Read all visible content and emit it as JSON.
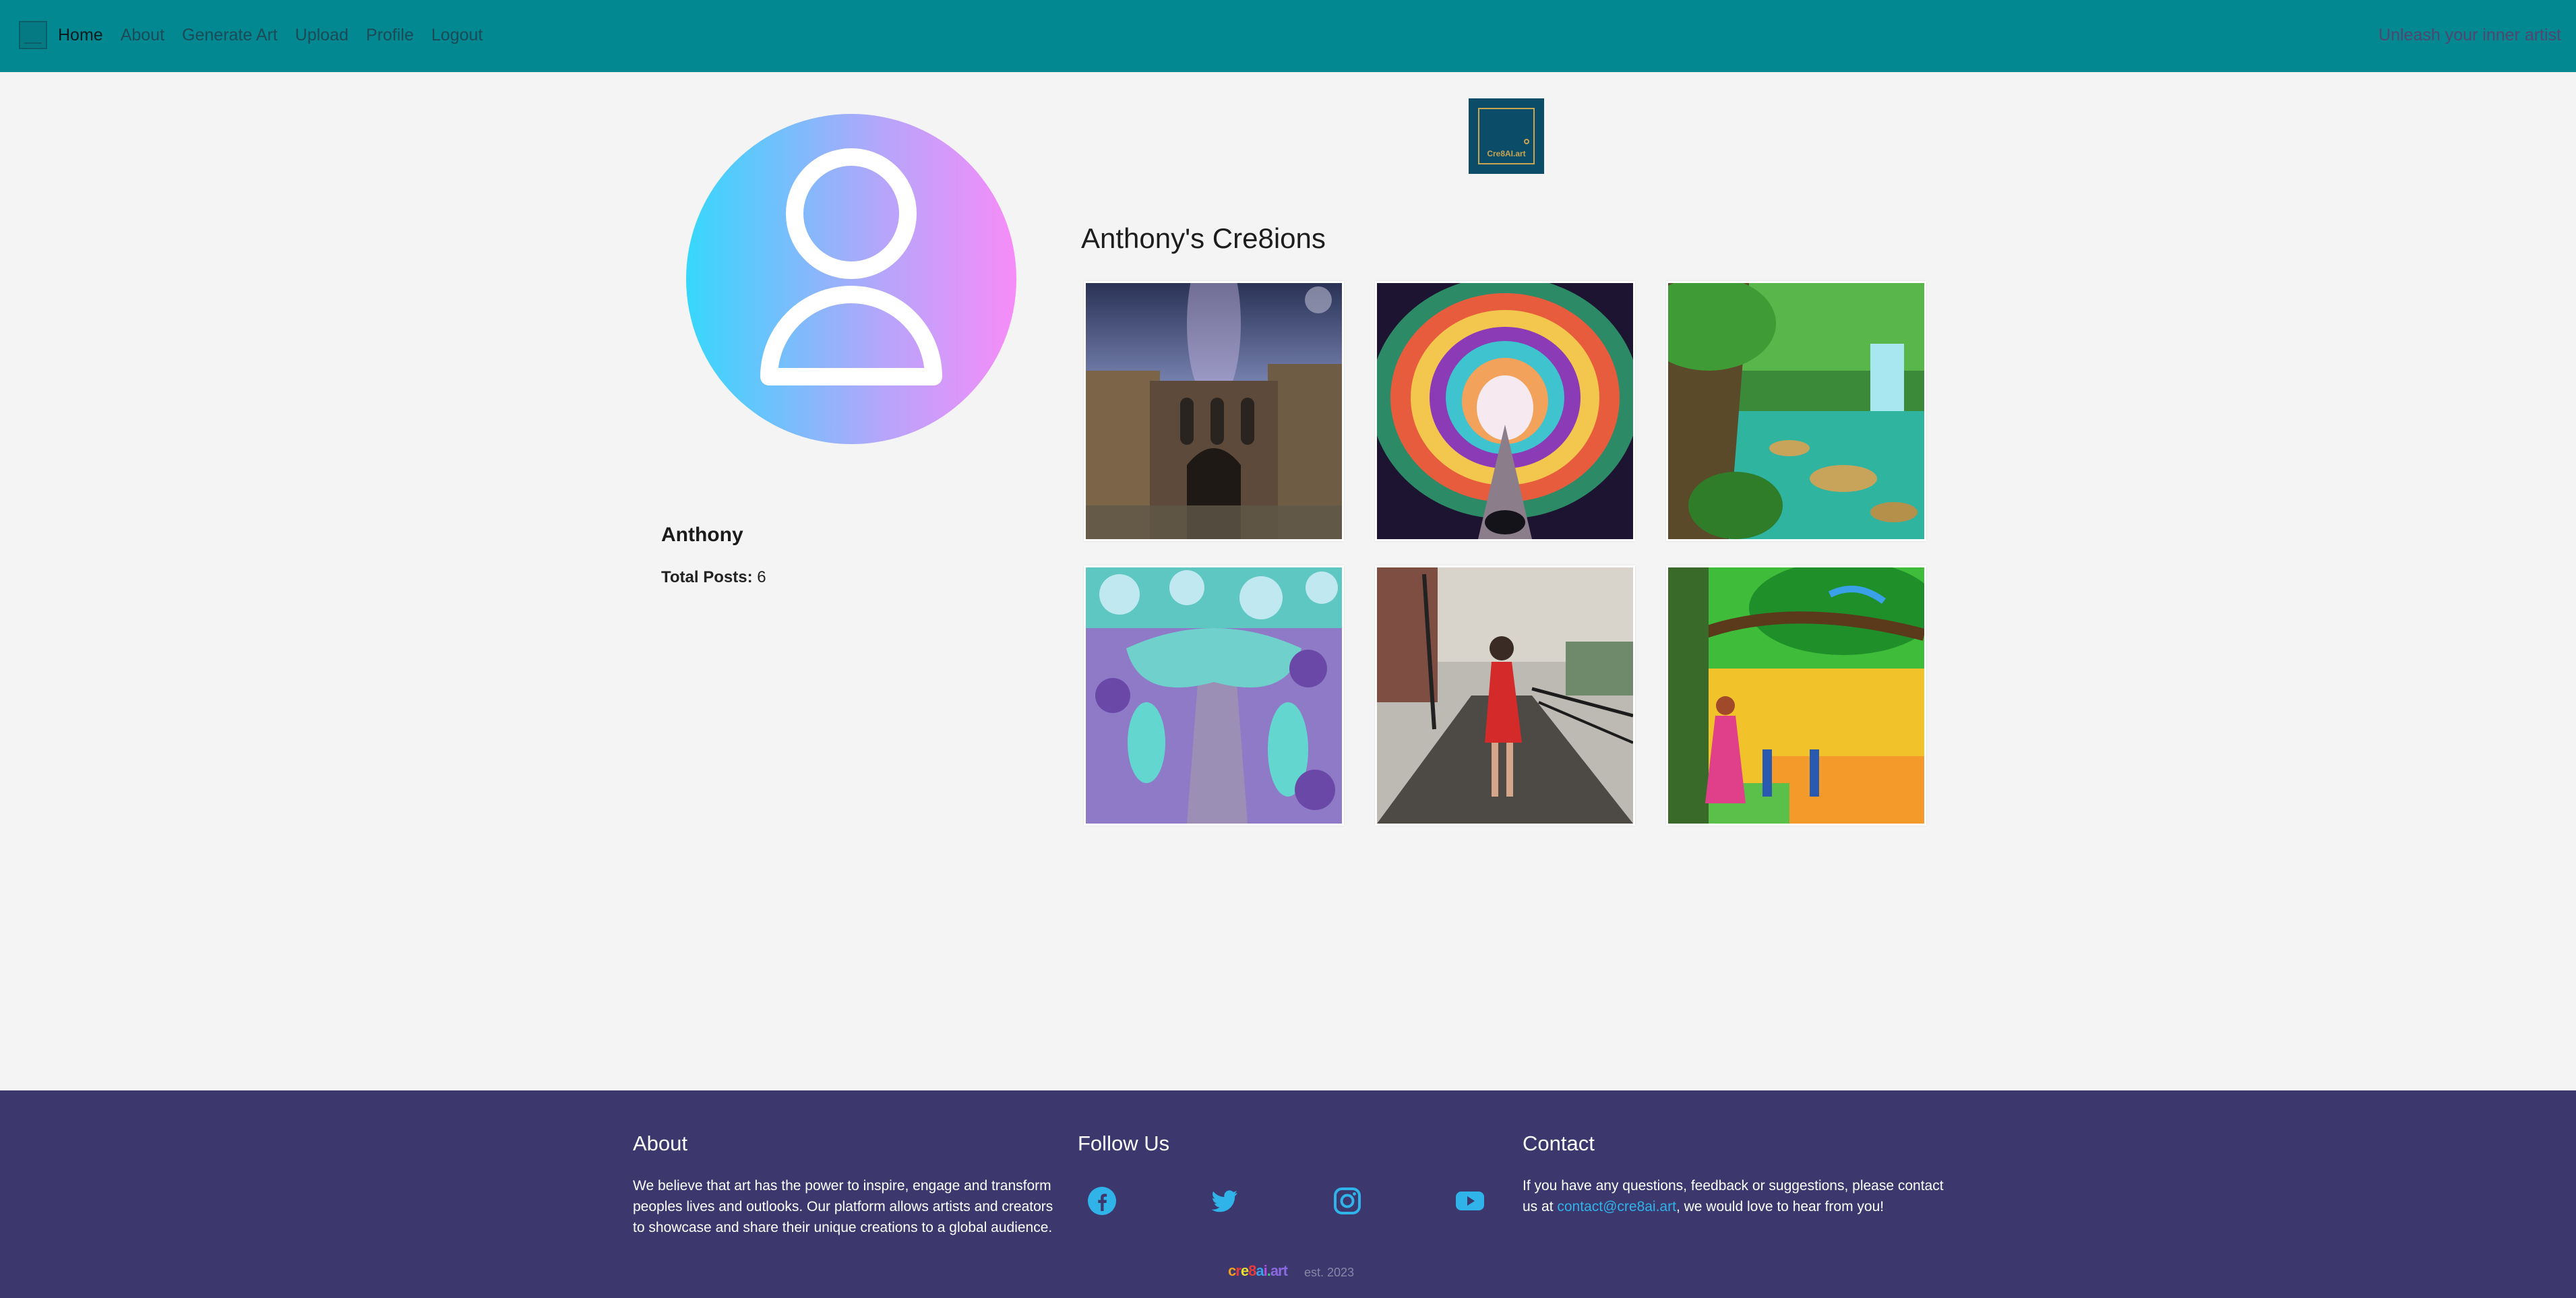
{
  "nav": {
    "links": [
      {
        "label": "Home"
      },
      {
        "label": "About"
      },
      {
        "label": "Generate Art"
      },
      {
        "label": "Upload"
      },
      {
        "label": "Profile"
      },
      {
        "label": "Logout"
      }
    ],
    "tagline": "Unleash your inner artist"
  },
  "profile": {
    "name": "Anthony",
    "total_posts_label": "Total Posts:",
    "total_posts_value": "6"
  },
  "logo": {
    "text": "Cre8AI.art"
  },
  "gallery": {
    "title": "Anthony's Cre8ions"
  },
  "footer": {
    "about_title": "About",
    "about_text": "We believe that art has the power to inspire, engage and transform peoples lives and outlooks. Our platform allows artists and creators to showcase and share their unique creations to a global audience.",
    "follow_title": "Follow Us",
    "contact_title": "Contact",
    "contact_text_before": "If you have any questions, feedback or suggestions, please contact us at ",
    "contact_email": "contact@cre8ai.art",
    "contact_text_after": ", we would love to hear from you!",
    "brand": "cre8ai.art",
    "est": "est. 2023"
  },
  "icons": [
    "facebook-icon",
    "twitter-icon",
    "instagram-icon",
    "youtube-icon"
  ],
  "colors": {
    "navbar": "#028891",
    "footer": "#3c376d",
    "link": "#2fb3e8",
    "background": "#f4f4f4"
  }
}
